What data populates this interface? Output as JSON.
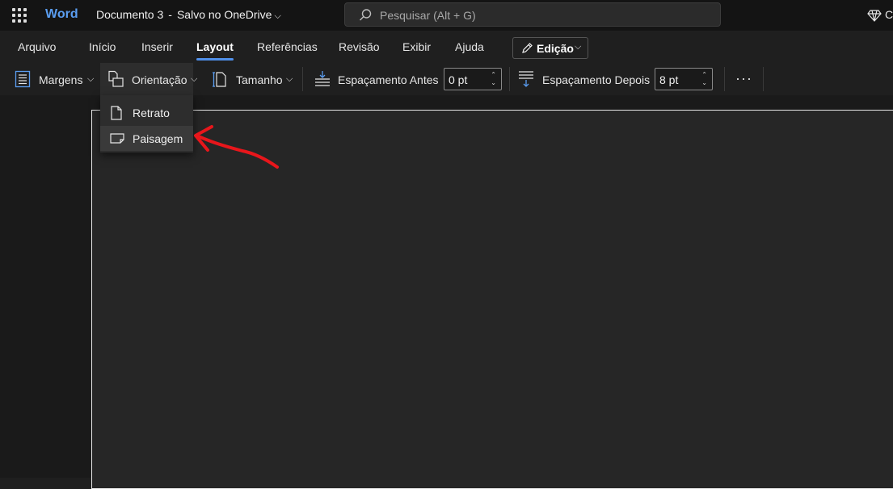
{
  "titlebar": {
    "app_name": "Word",
    "doc_title": "Documento 3",
    "separator": "-",
    "save_status": "Salvo no OneDrive",
    "search_placeholder": "Pesquisar (Alt + G)",
    "cut_text": "C"
  },
  "tabs": [
    {
      "label": "Arquivo"
    },
    {
      "label": "Início"
    },
    {
      "label": "Inserir"
    },
    {
      "label": "Layout",
      "active": true
    },
    {
      "label": "Referências"
    },
    {
      "label": "Revisão"
    },
    {
      "label": "Exibir"
    },
    {
      "label": "Ajuda"
    }
  ],
  "edit_mode": {
    "label": "Edição"
  },
  "ribbon": {
    "margins_label": "Margens",
    "orientation_label": "Orientação",
    "size_label": "Tamanho",
    "spacing_before_label": "Espaçamento Antes",
    "spacing_before_value": "0 pt",
    "spacing_after_label": "Espaçamento Depois",
    "spacing_after_value": "8 pt",
    "more_label": "···"
  },
  "orientation_menu": {
    "items": [
      {
        "label": "Retrato"
      },
      {
        "label": "Paisagem",
        "hovered": true
      }
    ]
  },
  "colors": {
    "accent": "#4f8fe8",
    "app_name": "#5a9df0",
    "annotation_arrow": "#e8161b",
    "background": "#1f1f1f"
  }
}
